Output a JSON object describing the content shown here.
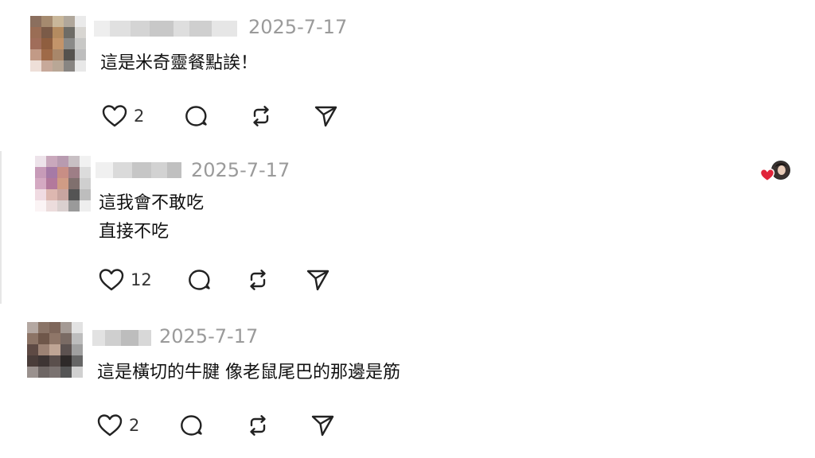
{
  "comments": [
    {
      "date": "2025-7-17",
      "lines": [
        "這是米奇靈餐點誒！"
      ],
      "likes": "2",
      "icons": [
        "heart-icon",
        "comment-icon",
        "repost-icon",
        "share-icon"
      ]
    },
    {
      "date": "2025-7-17",
      "lines": [
        "這我會不敢吃",
        "直接不吃"
      ],
      "likes": "12",
      "icons": [
        "heart-icon",
        "comment-icon",
        "repost-icon",
        "share-icon"
      ],
      "creator_liked": true
    },
    {
      "date": "2025-7-17",
      "lines": [
        "這是橫切的牛腱 像老鼠尾巴的那邊是筋"
      ],
      "likes": "2",
      "icons": [
        "heart-icon",
        "comment-icon",
        "repost-icon",
        "share-icon"
      ]
    }
  ],
  "colors": {
    "text": "#111111",
    "date": "#9a9a9a",
    "heart_badge": "#e0243a"
  }
}
